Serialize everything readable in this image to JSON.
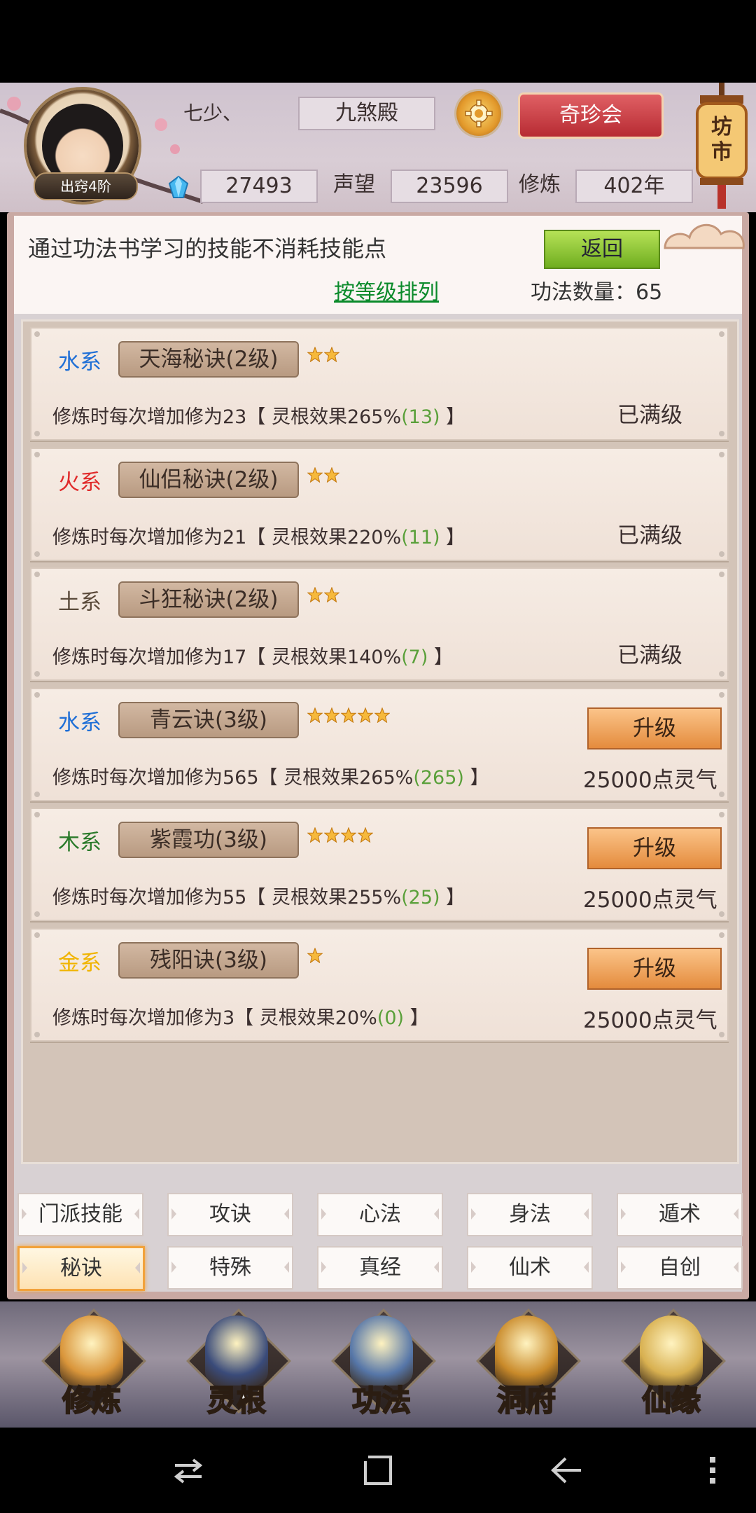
{
  "header": {
    "player_name": "七少、",
    "rank_badge": "出窍4阶",
    "sect": "九煞殿",
    "treasure_button": "奇珍会",
    "market_label": "坊市",
    "spirit_stones": "27493",
    "reputation_label": "声望",
    "reputation": "23596",
    "cultivation_label": "修炼",
    "cultivation": "402年"
  },
  "info": {
    "text": "通过功法书学习的技能不消耗技能点",
    "back_button": "返回",
    "sort_link": "按等级排列",
    "count_label": "功法数量：65"
  },
  "skills": [
    {
      "element": "水系",
      "element_color": "#1f6fd6",
      "name": "天海秘诀(2级)",
      "stars": 2,
      "effect_prefix": "修炼时每次增加修为23【 灵根效果265%",
      "effect_bonus": "(13)",
      "effect_suffix": " 】",
      "status": "已满级"
    },
    {
      "element": "火系",
      "element_color": "#e02a2a",
      "name": "仙侣秘诀(2级)",
      "stars": 2,
      "effect_prefix": "修炼时每次增加修为21【 灵根效果220%",
      "effect_bonus": "(11)",
      "effect_suffix": " 】",
      "status": "已满级"
    },
    {
      "element": "土系",
      "element_color": "#5a4a3a",
      "name": "斗狂秘诀(2级)",
      "stars": 2,
      "effect_prefix": "修炼时每次增加修为17【 灵根效果140%",
      "effect_bonus": "(7)",
      "effect_suffix": " 】",
      "status": "已满级"
    },
    {
      "element": "水系",
      "element_color": "#1f6fd6",
      "name": "青云诀(3级)",
      "stars": 5,
      "effect_prefix": "修炼时每次增加修为565【 灵根效果265%",
      "effect_bonus": "(265)",
      "effect_suffix": " 】",
      "upgrade_label": "升级",
      "cost": "25000点灵气"
    },
    {
      "element": "木系",
      "element_color": "#2a7a2a",
      "name": "紫霞功(3级)",
      "stars": 4,
      "effect_prefix": "修炼时每次增加修为55【 灵根效果255%",
      "effect_bonus": "(25)",
      "effect_suffix": " 】",
      "upgrade_label": "升级",
      "cost": "25000点灵气"
    },
    {
      "element": "金系",
      "element_color": "#f0b400",
      "name": "残阳诀(3级)",
      "stars": 1,
      "effect_prefix": "修炼时每次增加修为3【 灵根效果20%",
      "effect_bonus": "(0)",
      "effect_suffix": " 】",
      "upgrade_label": "升级",
      "cost": "25000点灵气"
    }
  ],
  "categories": [
    {
      "label": "门派技能",
      "active": false
    },
    {
      "label": "攻诀",
      "active": false
    },
    {
      "label": "心法",
      "active": false
    },
    {
      "label": "身法",
      "active": false
    },
    {
      "label": "遁术",
      "active": false
    },
    {
      "label": "秘诀",
      "active": true
    },
    {
      "label": "特殊",
      "active": false
    },
    {
      "label": "真经",
      "active": false
    },
    {
      "label": "仙术",
      "active": false
    },
    {
      "label": "自创",
      "active": false
    }
  ],
  "nav": [
    {
      "label": "修炼",
      "icon": "monk-icon",
      "active": false
    },
    {
      "label": "灵根",
      "icon": "sword-icon",
      "active": false
    },
    {
      "label": "功法",
      "icon": "book-icon",
      "active": true
    },
    {
      "label": "洞府",
      "icon": "pagoda-icon",
      "active": false
    },
    {
      "label": "仙缘",
      "icon": "gourd-icon",
      "active": false
    }
  ],
  "colors": {
    "accent_orange": "#e48b3d",
    "green_bonus": "#5aa03a",
    "back_green": "#6fae1f",
    "nav_active": "#ffd23a"
  }
}
